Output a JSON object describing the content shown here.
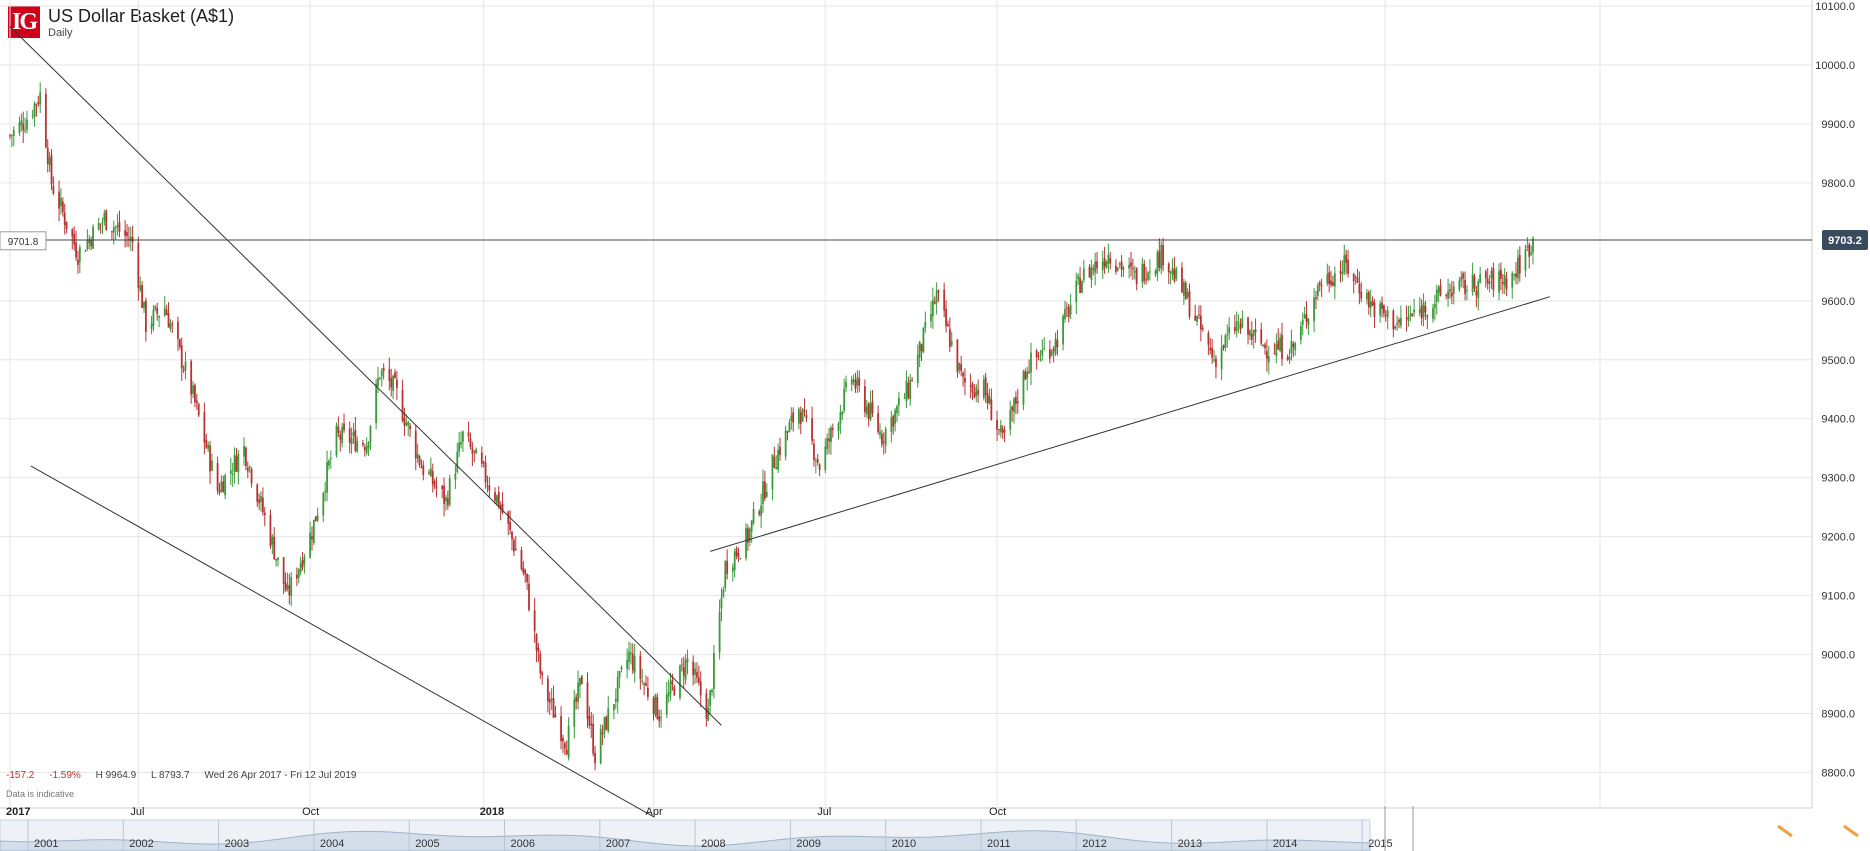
{
  "header": {
    "logo_text": "IG",
    "title": "US Dollar Basket (A$1)",
    "timeframe": "Daily"
  },
  "stats": {
    "change": "-157.2",
    "change_pct": "-1.59%",
    "high": "H 9964.9",
    "low": "L 8793.7",
    "range": "Wed 26 Apr 2017 - Fri 12 Jul 2019"
  },
  "footer": {
    "indicative": "Data is indicative"
  },
  "colors": {
    "up": "#3a9a3a",
    "down": "#b83232",
    "grid": "#e6e6e6",
    "accent_label": "#3a4a5e",
    "logo": "#d0021b"
  },
  "chart_data": {
    "type": "candlestick",
    "title": "US Dollar Basket (A$1)",
    "ylim": [
      8750,
      10100
    ],
    "y_ticks": [
      {
        "value": 10100,
        "label": "10100.0"
      },
      {
        "value": 10000,
        "label": "10000.0"
      },
      {
        "value": 9900,
        "label": "9900.0"
      },
      {
        "value": 9800,
        "label": "9800.0"
      },
      {
        "value": 9600,
        "label": "9600.0"
      },
      {
        "value": 9500,
        "label": "9500.0"
      },
      {
        "value": 9400,
        "label": "9400.0"
      },
      {
        "value": 9300,
        "label": "9300.0"
      },
      {
        "value": 9200,
        "label": "9200.0"
      },
      {
        "value": 9100,
        "label": "9100.0"
      },
      {
        "value": 9000,
        "label": "9000.0"
      },
      {
        "value": 8900,
        "label": "8900.0"
      },
      {
        "value": 8800,
        "label": "8800.0"
      }
    ],
    "x_ticks": [
      {
        "date": "2017-04-26",
        "label": "2017",
        "bold": true
      },
      {
        "date": "2017-07-03",
        "label": "Jul",
        "bold": false
      },
      {
        "date": "2017-10-02",
        "label": "Oct",
        "bold": false
      },
      {
        "date": "2018-01-02",
        "label": "2018",
        "bold": true
      },
      {
        "date": "2018-04-02",
        "label": "Apr",
        "bold": false
      },
      {
        "date": "2018-07-02",
        "label": "Jul",
        "bold": false
      },
      {
        "date": "2018-10-01",
        "label": "Oct",
        "bold": false
      }
    ],
    "x_start": "2017-04-26",
    "x_end": "2019-07-12",
    "horizontal_line": {
      "value": 9703.2,
      "label": "9703.2"
    },
    "left_marker": {
      "value": 9701.8,
      "label": "9701.8"
    },
    "trendlines": [
      {
        "name": "upper-downtrend",
        "from": {
          "date": "2017-04-26",
          "value": 10065
        },
        "to": {
          "date": "2018-05-08",
          "value": 8880
        }
      },
      {
        "name": "lower-downtrend",
        "from": {
          "date": "2017-05-07",
          "value": 9320
        },
        "to": {
          "date": "2018-04-02",
          "value": 8725
        }
      },
      {
        "name": "uptrend-support",
        "from": {
          "date": "2018-05-02",
          "value": 9175
        },
        "to": {
          "date": "2019-07-21",
          "value": 9607
        }
      }
    ],
    "price_path": [
      {
        "date": "2017-04-26",
        "value": 9880
      },
      {
        "date": "2017-05-04",
        "value": 9905
      },
      {
        "date": "2017-05-12",
        "value": 9950
      },
      {
        "date": "2017-05-18",
        "value": 9800
      },
      {
        "date": "2017-06-01",
        "value": 9680
      },
      {
        "date": "2017-06-15",
        "value": 9740
      },
      {
        "date": "2017-06-30",
        "value": 9700
      },
      {
        "date": "2017-07-07",
        "value": 9560
      },
      {
        "date": "2017-07-17",
        "value": 9590
      },
      {
        "date": "2017-07-31",
        "value": 9450
      },
      {
        "date": "2017-08-14",
        "value": 9280
      },
      {
        "date": "2017-08-28",
        "value": 9350
      },
      {
        "date": "2017-09-11",
        "value": 9200
      },
      {
        "date": "2017-09-20",
        "value": 9100
      },
      {
        "date": "2017-10-03",
        "value": 9210
      },
      {
        "date": "2017-10-16",
        "value": 9370
      },
      {
        "date": "2017-11-01",
        "value": 9360
      },
      {
        "date": "2017-11-08",
        "value": 9480
      },
      {
        "date": "2017-11-16",
        "value": 9450
      },
      {
        "date": "2017-11-30",
        "value": 9320
      },
      {
        "date": "2017-12-13",
        "value": 9260
      },
      {
        "date": "2017-12-22",
        "value": 9370
      },
      {
        "date": "2018-01-10",
        "value": 9260
      },
      {
        "date": "2018-01-24",
        "value": 9130
      },
      {
        "date": "2018-02-02",
        "value": 8950
      },
      {
        "date": "2018-02-15",
        "value": 8850
      },
      {
        "date": "2018-02-23",
        "value": 8960
      },
      {
        "date": "2018-03-02",
        "value": 8830
      },
      {
        "date": "2018-03-20",
        "value": 9000
      },
      {
        "date": "2018-04-05",
        "value": 8900
      },
      {
        "date": "2018-04-20",
        "value": 8990
      },
      {
        "date": "2018-05-01",
        "value": 8900
      },
      {
        "date": "2018-05-10",
        "value": 9150
      },
      {
        "date": "2018-05-22",
        "value": 9200
      },
      {
        "date": "2018-06-05",
        "value": 9330
      },
      {
        "date": "2018-06-18",
        "value": 9420
      },
      {
        "date": "2018-06-29",
        "value": 9320
      },
      {
        "date": "2018-07-16",
        "value": 9470
      },
      {
        "date": "2018-08-01",
        "value": 9370
      },
      {
        "date": "2018-08-15",
        "value": 9450
      },
      {
        "date": "2018-08-30",
        "value": 9610
      },
      {
        "date": "2018-09-13",
        "value": 9460
      },
      {
        "date": "2018-09-24",
        "value": 9450
      },
      {
        "date": "2018-10-04",
        "value": 9360
      },
      {
        "date": "2018-10-17",
        "value": 9490
      },
      {
        "date": "2018-11-01",
        "value": 9530
      },
      {
        "date": "2018-11-15",
        "value": 9640
      },
      {
        "date": "2018-11-29",
        "value": 9680
      },
      {
        "date": "2018-12-13",
        "value": 9640
      },
      {
        "date": "2018-12-28",
        "value": 9680
      },
      {
        "date": "2019-01-10",
        "value": 9600
      },
      {
        "date": "2019-01-24",
        "value": 9500
      },
      {
        "date": "2019-02-05",
        "value": 9560
      },
      {
        "date": "2019-02-21",
        "value": 9520
      },
      {
        "date": "2019-03-07",
        "value": 9520
      },
      {
        "date": "2019-03-21",
        "value": 9630
      },
      {
        "date": "2019-04-04",
        "value": 9660
      },
      {
        "date": "2019-04-18",
        "value": 9590
      },
      {
        "date": "2019-05-02",
        "value": 9560
      },
      {
        "date": "2019-05-16",
        "value": 9590
      },
      {
        "date": "2019-05-30",
        "value": 9620
      },
      {
        "date": "2019-07-01",
        "value": 9640
      },
      {
        "date": "2019-07-12",
        "value": 9703
      }
    ],
    "navigator": {
      "years": [
        "2001",
        "2002",
        "2003",
        "2004",
        "2005",
        "2006",
        "2007",
        "2008",
        "2009",
        "2010",
        "2011",
        "2012",
        "2013",
        "2014",
        "2015"
      ]
    }
  }
}
